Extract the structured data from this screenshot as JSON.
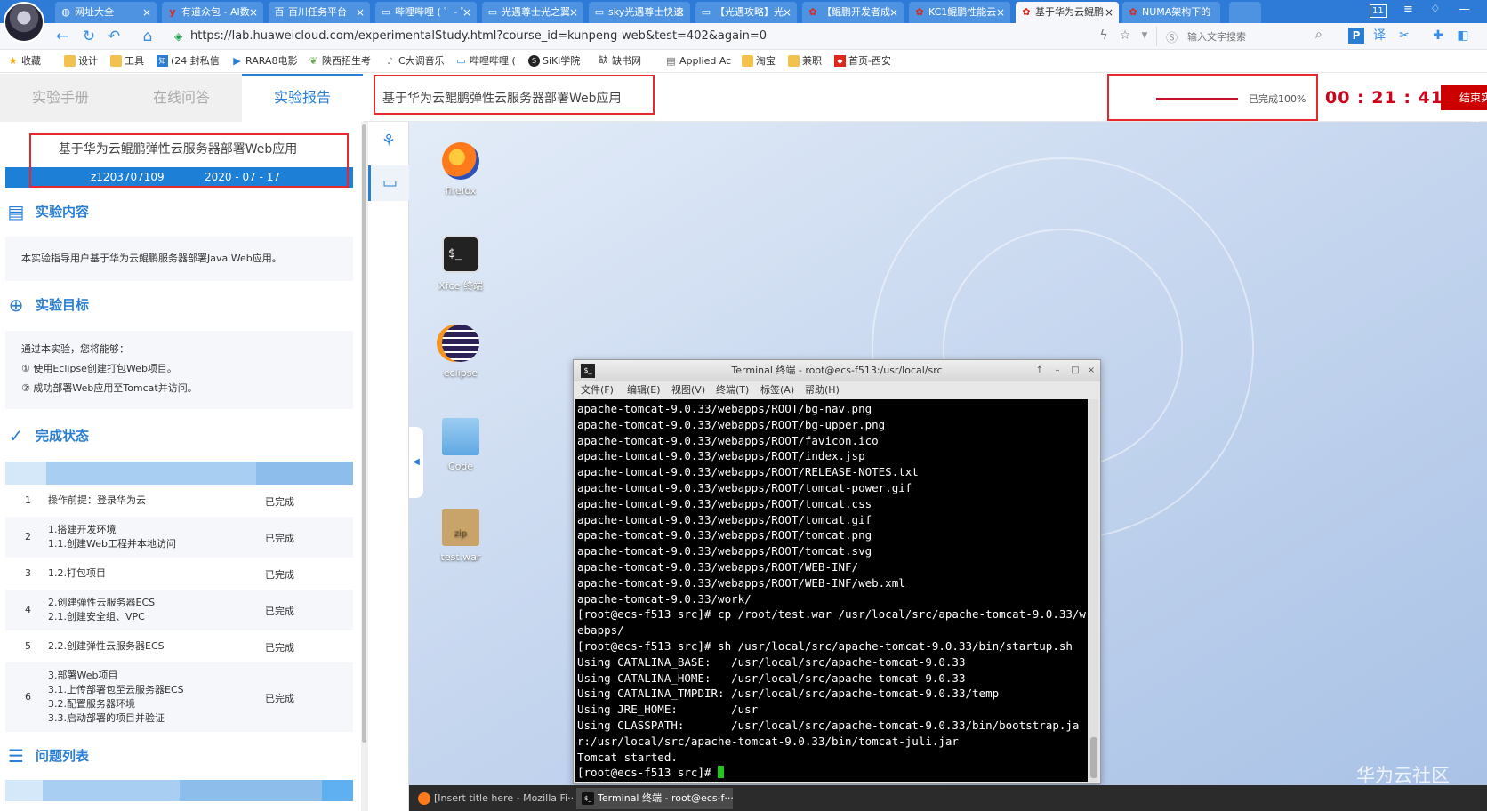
{
  "browser": {
    "tabs": [
      {
        "label": "网址大全",
        "icon": "globe-icon"
      },
      {
        "label": "有道众包 - AI数",
        "icon": "youdao-icon"
      },
      {
        "label": "百川任务平台",
        "icon": "baichuan-icon"
      },
      {
        "label": "哔哩哔哩 ( ゜- ゜",
        "icon": "bilibili-icon"
      },
      {
        "label": "光遇尊士光之翼",
        "icon": "bilibili-icon"
      },
      {
        "label": "sky光遇尊士快速",
        "icon": "bilibili-icon"
      },
      {
        "label": "【光遇攻略】光",
        "icon": "bilibili-icon"
      },
      {
        "label": "【鲲鹏开发者成",
        "icon": "huawei-icon"
      },
      {
        "label": "KC1鲲鹏性能云",
        "icon": "huawei-icon"
      },
      {
        "label": "基于华为云鲲鹏",
        "icon": "huawei-icon"
      },
      {
        "label": "NUMA架构下的",
        "icon": "huawei-icon"
      }
    ],
    "tab_count": "11",
    "url": "https://lab.huaweicloud.com/experimentalStudy.html?course_id=kunpeng-web&test=402&again=0",
    "search_placeholder": "输入文字搜索",
    "bookmarks": [
      "收藏",
      "设计",
      "工具",
      "(24 封私信",
      "RARA8电影",
      "陕西招生考",
      "C大调音乐",
      "哔哩哔哩 (",
      "SiKi学院",
      "缺书网",
      "Applied Ac",
      "淘宝",
      "兼职",
      "首页-西安"
    ]
  },
  "header": {
    "tabs": [
      "实验手册",
      "在线问答",
      "实验报告"
    ],
    "active_tab": 2,
    "experiment_title": "基于华为云鲲鹏弹性云服务器部署Web应用",
    "progress_text": "已完成100%",
    "progress_value": 1.0,
    "timer": "00 : 21 : 41",
    "end_button": "结束实验"
  },
  "report": {
    "title": "基于华为云鲲鹏弹性云服务器部署Web应用",
    "user": "z1203707109",
    "date": "2020 - 07 - 17",
    "content_heading": "实验内容",
    "content_text": "本实验指导用户基于华为云鲲鹏服务器部署Java Web应用。",
    "goal_heading": "实验目标",
    "goal_intro": "通过本实验，您将能够：",
    "goals": [
      "① 使用Eclipse创建打包Web项目。",
      "② 成功部署Web应用至Tomcat并访问。"
    ],
    "status_heading": "完成状态",
    "status_rows": [
      {
        "num": "1",
        "task": [
          "操作前提：登录华为云"
        ],
        "status": "已完成"
      },
      {
        "num": "2",
        "task": [
          "1.搭建开发环境",
          "1.1.创建Web工程并本地访问"
        ],
        "status": "已完成"
      },
      {
        "num": "3",
        "task": [
          "1.2.打包项目"
        ],
        "status": "已完成"
      },
      {
        "num": "4",
        "task": [
          "2.创建弹性云服务器ECS",
          "2.1.创建安全组、VPC"
        ],
        "status": "已完成"
      },
      {
        "num": "5",
        "task": [
          "2.2.创建弹性云服务器ECS"
        ],
        "status": "已完成"
      },
      {
        "num": "6",
        "task": [
          "3.部署Web项目",
          "3.1.上传部署包至云服务器ECS",
          "3.2.配置服务器环境",
          "3.3.启动部署的项目并验证"
        ],
        "status": "已完成"
      }
    ],
    "issues_heading": "问题列表"
  },
  "desktop": {
    "icons": [
      {
        "label": "firefox",
        "icon": "firefox-icon"
      },
      {
        "label": "Xfce 终端",
        "icon": "terminal-icon"
      },
      {
        "label": "eclipse",
        "icon": "eclipse-icon"
      },
      {
        "label": "Code",
        "icon": "folder-icon"
      },
      {
        "label": "test.war",
        "icon": "zip-icon"
      }
    ],
    "watermark": "华为云社区",
    "taskbar": [
      {
        "label": "[Insert title here - Mozilla Fi···",
        "icon": "firefox-icon"
      },
      {
        "label": "Terminal 终端 - root@ecs-f···",
        "icon": "terminal-icon"
      }
    ]
  },
  "terminal": {
    "title": "Terminal 终端 - root@ecs-f513:/usr/local/src",
    "menu": [
      "文件(F)",
      "编辑(E)",
      "视图(V)",
      "终端(T)",
      "标签(A)",
      "帮助(H)"
    ],
    "lines": [
      "apache-tomcat-9.0.33/webapps/ROOT/bg-nav.png",
      "apache-tomcat-9.0.33/webapps/ROOT/bg-upper.png",
      "apache-tomcat-9.0.33/webapps/ROOT/favicon.ico",
      "apache-tomcat-9.0.33/webapps/ROOT/index.jsp",
      "apache-tomcat-9.0.33/webapps/ROOT/RELEASE-NOTES.txt",
      "apache-tomcat-9.0.33/webapps/ROOT/tomcat-power.gif",
      "apache-tomcat-9.0.33/webapps/ROOT/tomcat.css",
      "apache-tomcat-9.0.33/webapps/ROOT/tomcat.gif",
      "apache-tomcat-9.0.33/webapps/ROOT/tomcat.png",
      "apache-tomcat-9.0.33/webapps/ROOT/tomcat.svg",
      "apache-tomcat-9.0.33/webapps/ROOT/WEB-INF/",
      "apache-tomcat-9.0.33/webapps/ROOT/WEB-INF/web.xml",
      "apache-tomcat-9.0.33/work/",
      "[root@ecs-f513 src]# cp /root/test.war /usr/local/src/apache-tomcat-9.0.33/webapps/",
      "[root@ecs-f513 src]# sh /usr/local/src/apache-tomcat-9.0.33/bin/startup.sh",
      "Using CATALINA_BASE:   /usr/local/src/apache-tomcat-9.0.33",
      "Using CATALINA_HOME:   /usr/local/src/apache-tomcat-9.0.33",
      "Using CATALINA_TMPDIR: /usr/local/src/apache-tomcat-9.0.33/temp",
      "Using JRE_HOME:        /usr",
      "Using CLASSPATH:       /usr/local/src/apache-tomcat-9.0.33/bin/bootstrap.jar:/usr/local/src/apache-tomcat-9.0.33/bin/tomcat-juli.jar",
      "Tomcat started."
    ],
    "prompt": "[root@ecs-f513 src]# "
  },
  "colors": {
    "brand_blue": "#2a7fd4",
    "alert_red": "#d0021b",
    "annotation_red": "#e8282f"
  }
}
